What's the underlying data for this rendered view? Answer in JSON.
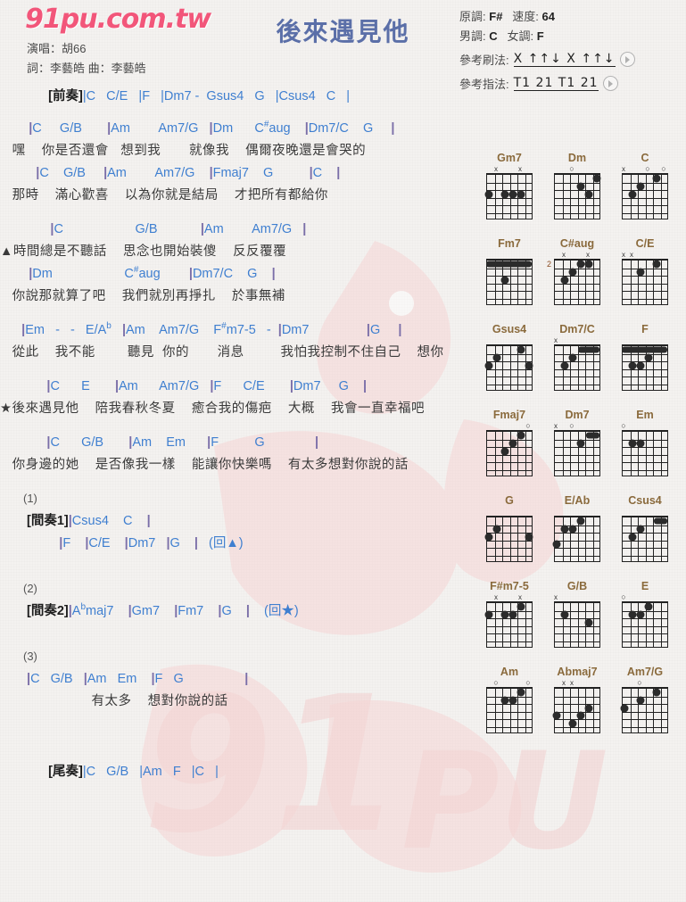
{
  "site": {
    "logo": "91pu.com.tw"
  },
  "header": {
    "title": "後來遇見他",
    "performer": "演唱：胡66",
    "credit": "詞：李藝皓  曲：李藝皓",
    "original_key_label": "原調:",
    "original_key": "F#",
    "tempo_label": "速度:",
    "tempo": "64",
    "male_key_label": "男調:",
    "male_key": "C",
    "female_key_label": "女調:",
    "female_key": "F",
    "strum_label": "參考刷法:",
    "strum_pattern": "X ↑↑↓ X ↑↑↓",
    "finger_label": "參考指法:",
    "finger_pattern": "T1 21 T1 21",
    "play_icon": "play-icon"
  },
  "sheet": {
    "intro_tag": "[前奏]",
    "intro_chords": "|C   C/E   |F   |Dm7 -  Gsus4   G   |Csus4   C   |",
    "blocks": [
      {
        "chords": "        |C     G/B       |Am        Am7/G   |Dm      C#aug    |Dm7/C    G     |",
        "lyrics": "   嘿    你是否還會   想到我       就像我    偶爾夜晚還是會哭的"
      },
      {
        "chords": "          |C    G/B     |Am        Am7/G    |Fmaj7    G          |C    |",
        "lyrics": "   那時    滿心歡喜    以為你就是結局    才把所有都給你"
      },
      {
        "chords": "              |C                    G/B            |Am        Am7/G   |",
        "lyrics": "▲時間總是不聽話    思念也開始裝傻    反反覆覆"
      },
      {
        "chords": "        |Dm                    C#aug        |Dm7/C    G    |",
        "lyrics": "   你說那就算了吧    我們就別再掙扎    於事無補"
      },
      {
        "chords": "      |Em   -   -   E/Ab   |Am    Am7/G    F#m7-5   -  |Dm7                |G     |",
        "lyrics": "   從此    我不能        聽見  你的       消息         我怕我控制不住自己    想你"
      },
      {
        "chords": "             |C      E       |Am      Am7/G   |F      C/E       |Dm7     G    |",
        "lyrics": "★後來遇見他    陪我春秋冬夏    癒合我的傷疤    大概    我會一直幸福吧"
      },
      {
        "chords": "             |C      G/B       |Am    Em      |F          G              |",
        "lyrics": "   你身邊的她    是否像我一樣    能讓你快樂嗎    有太多想對你說的話"
      }
    ],
    "sections": [
      {
        "number": "(1)",
        "tag": "[間奏1]",
        "lines": [
          "|Csus4    C    |",
          "         |F    |C/E    |Dm7   |G    |   (回▲)"
        ]
      },
      {
        "number": "(2)",
        "tag": "[間奏2]",
        "lines": [
          "|Abmaj7    |Gm7    |Fm7    |G    |    (回★)"
        ]
      },
      {
        "number": "(3)",
        "tag": "",
        "lines": [
          "|C   G/B   |Am   Em    |F   G                 |"
        ],
        "lyrics": "                有太多    想對你說的話"
      }
    ],
    "outro_tag": "[尾奏]",
    "outro_chords": "|C   G/B   |Am   F   |C   |"
  },
  "chords": [
    {
      "name": "Gm7",
      "markers": [
        "",
        "x",
        "",
        "",
        "x",
        ""
      ],
      "dots": [
        {
          "s": 6,
          "f": 3
        },
        {
          "s": 4,
          "f": 3
        },
        {
          "s": 3,
          "f": 3
        },
        {
          "s": 2,
          "f": 3
        }
      ],
      "barre": null,
      "fret": ""
    },
    {
      "name": "Dm",
      "markers": [
        "",
        "",
        "o",
        "",
        "",
        ""
      ],
      "dots": [
        {
          "s": 1,
          "f": 1
        },
        {
          "s": 2,
          "f": 3
        },
        {
          "s": 3,
          "f": 2
        }
      ],
      "barre": null,
      "fret": ""
    },
    {
      "name": "C",
      "markers": [
        "x",
        "",
        "",
        "o",
        "",
        "o"
      ],
      "dots": [
        {
          "s": 5,
          "f": 3
        },
        {
          "s": 4,
          "f": 2
        },
        {
          "s": 2,
          "f": 1
        }
      ],
      "barre": null,
      "fret": ""
    },
    {
      "name": "Fm7",
      "markers": [
        "",
        "",
        "",
        "",
        "",
        ""
      ],
      "dots": [
        {
          "s": 4,
          "f": 3
        }
      ],
      "barre": {
        "f": 1,
        "from": 6,
        "to": 1
      },
      "fret": ""
    },
    {
      "name": "C#aug",
      "markers": [
        "",
        "x",
        "",
        "",
        "x",
        ""
      ],
      "dots": [
        {
          "s": 5,
          "f": 3
        },
        {
          "s": 4,
          "f": 2
        },
        {
          "s": 3,
          "f": 1
        },
        {
          "s": 2,
          "f": 1
        }
      ],
      "barre": null,
      "fret": "2"
    },
    {
      "name": "C/E",
      "markers": [
        "x",
        "x",
        "",
        "",
        "",
        ""
      ],
      "dots": [
        {
          "s": 4,
          "f": 2
        },
        {
          "s": 2,
          "f": 1
        }
      ],
      "barre": null,
      "fret": ""
    },
    {
      "name": "Gsus4",
      "markers": [
        "",
        "",
        "",
        "",
        "",
        ""
      ],
      "dots": [
        {
          "s": 6,
          "f": 3
        },
        {
          "s": 5,
          "f": 2
        },
        {
          "s": 2,
          "f": 1
        },
        {
          "s": 1,
          "f": 3
        }
      ],
      "barre": null,
      "fret": ""
    },
    {
      "name": "Dm7/C",
      "markers": [
        "x",
        "",
        "",
        "",
        "",
        ""
      ],
      "dots": [
        {
          "s": 5,
          "f": 3
        },
        {
          "s": 4,
          "f": 2
        }
      ],
      "barre": {
        "f": 1,
        "from": 3,
        "to": 1
      },
      "fret": ""
    },
    {
      "name": "F",
      "markers": [
        "",
        "",
        "",
        "",
        "",
        ""
      ],
      "dots": [
        {
          "s": 4,
          "f": 3
        },
        {
          "s": 3,
          "f": 2
        },
        {
          "s": 5,
          "f": 3
        }
      ],
      "barre": {
        "f": 1,
        "from": 6,
        "to": 1
      },
      "fret": ""
    },
    {
      "name": "Fmaj7",
      "markers": [
        "",
        "",
        "",
        "",
        "",
        "o"
      ],
      "dots": [
        {
          "s": 4,
          "f": 3
        },
        {
          "s": 3,
          "f": 2
        },
        {
          "s": 2,
          "f": 1
        }
      ],
      "barre": null,
      "fret": ""
    },
    {
      "name": "Dm7",
      "markers": [
        "x",
        "",
        "o",
        "",
        "",
        ""
      ],
      "dots": [
        {
          "s": 3,
          "f": 2
        }
      ],
      "barre": {
        "f": 1,
        "from": 2,
        "to": 1
      },
      "fret": ""
    },
    {
      "name": "Em",
      "markers": [
        "o",
        "",
        "",
        "",
        "",
        ""
      ],
      "dots": [
        {
          "s": 5,
          "f": 2
        },
        {
          "s": 4,
          "f": 2
        }
      ],
      "barre": null,
      "fret": ""
    },
    {
      "name": "G",
      "markers": [
        "",
        "",
        "",
        "",
        "",
        ""
      ],
      "dots": [
        {
          "s": 6,
          "f": 3
        },
        {
          "s": 5,
          "f": 2
        },
        {
          "s": 1,
          "f": 3
        }
      ],
      "barre": null,
      "fret": ""
    },
    {
      "name": "E/Ab",
      "markers": [
        "",
        "",
        "",
        "",
        "",
        ""
      ],
      "dots": [
        {
          "s": 6,
          "f": 4
        },
        {
          "s": 5,
          "f": 2
        },
        {
          "s": 4,
          "f": 2
        },
        {
          "s": 3,
          "f": 1
        }
      ],
      "barre": null,
      "fret": ""
    },
    {
      "name": "Csus4",
      "markers": [
        "",
        "",
        "",
        "",
        "",
        ""
      ],
      "dots": [
        {
          "s": 5,
          "f": 3
        },
        {
          "s": 4,
          "f": 2
        }
      ],
      "barre": {
        "f": 1,
        "from": 2,
        "to": 1
      },
      "fret": ""
    },
    {
      "name": "F#m7-5",
      "markers": [
        "",
        "x",
        "",
        "",
        "x",
        ""
      ],
      "dots": [
        {
          "s": 6,
          "f": 2
        },
        {
          "s": 4,
          "f": 2
        },
        {
          "s": 3,
          "f": 2
        },
        {
          "s": 2,
          "f": 1
        }
      ],
      "barre": null,
      "fret": ""
    },
    {
      "name": "G/B",
      "markers": [
        "x",
        "",
        "",
        "",
        "",
        ""
      ],
      "dots": [
        {
          "s": 5,
          "f": 2
        },
        {
          "s": 2,
          "f": 3
        }
      ],
      "barre": null,
      "fret": ""
    },
    {
      "name": "E",
      "markers": [
        "o",
        "",
        "",
        "",
        "",
        ""
      ],
      "dots": [
        {
          "s": 5,
          "f": 2
        },
        {
          "s": 4,
          "f": 2
        },
        {
          "s": 3,
          "f": 1
        }
      ],
      "barre": null,
      "fret": ""
    },
    {
      "name": "Am",
      "markers": [
        "",
        "o",
        "",
        "",
        "",
        "o"
      ],
      "dots": [
        {
          "s": 4,
          "f": 2
        },
        {
          "s": 3,
          "f": 2
        },
        {
          "s": 2,
          "f": 1
        }
      ],
      "barre": null,
      "fret": ""
    },
    {
      "name": "Abmaj7",
      "markers": [
        "",
        "x",
        "x",
        "",
        "",
        ""
      ],
      "dots": [
        {
          "s": 6,
          "f": 4
        },
        {
          "s": 4,
          "f": 5
        },
        {
          "s": 3,
          "f": 4
        },
        {
          "s": 2,
          "f": 3
        }
      ],
      "barre": null,
      "fret": ""
    },
    {
      "name": "Am7/G",
      "markers": [
        "",
        "",
        "o",
        "",
        "",
        ""
      ],
      "dots": [
        {
          "s": 6,
          "f": 3
        },
        {
          "s": 4,
          "f": 2
        },
        {
          "s": 2,
          "f": 1
        }
      ],
      "barre": null,
      "fret": ""
    }
  ]
}
